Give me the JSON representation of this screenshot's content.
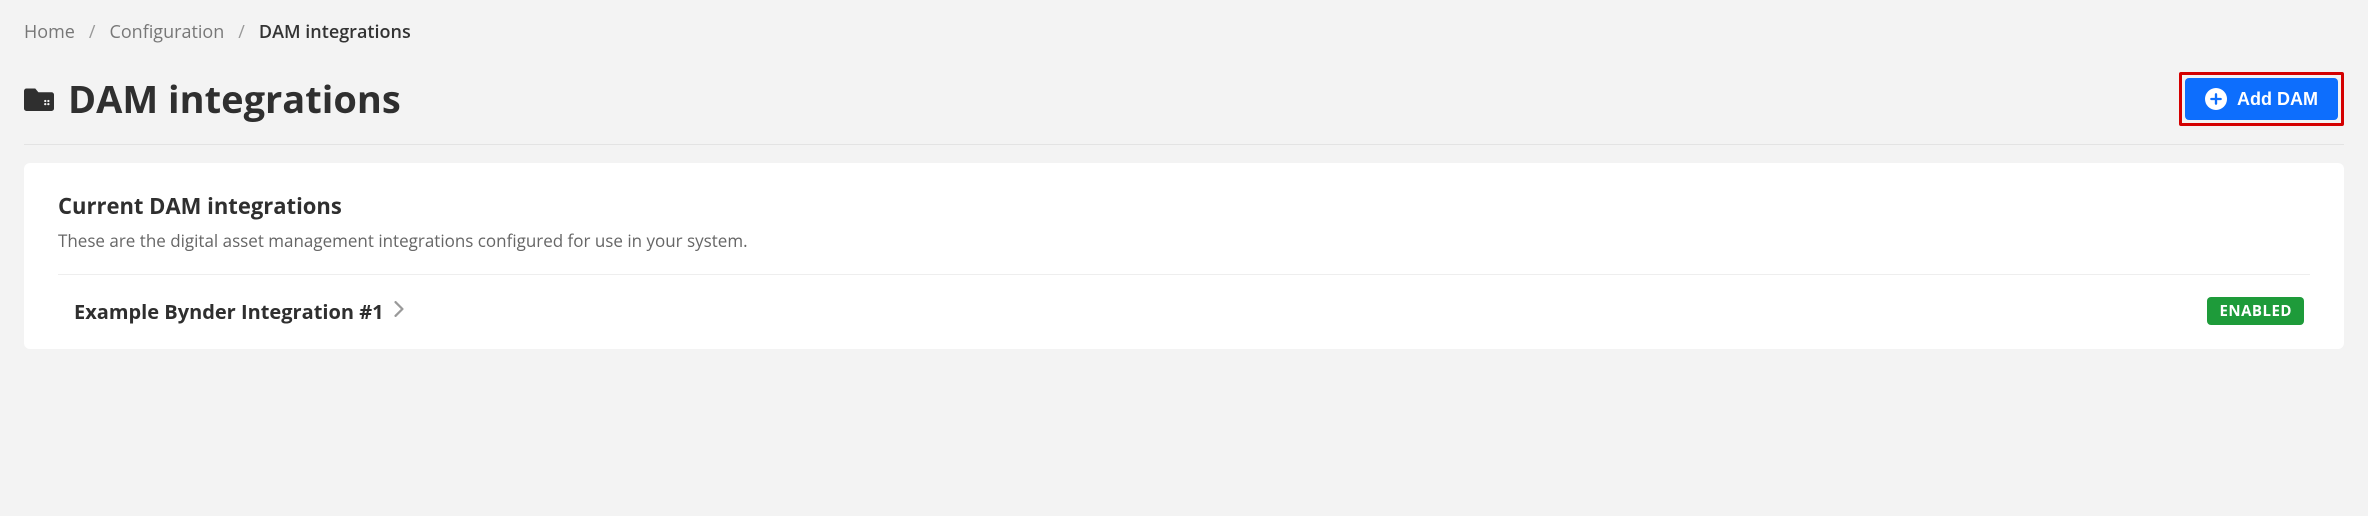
{
  "breadcrumb": {
    "home": "Home",
    "configuration": "Configuration",
    "current": "DAM integrations"
  },
  "page": {
    "title": "DAM integrations",
    "add_button": "Add DAM"
  },
  "card": {
    "title": "Current DAM integrations",
    "description": "These are the digital asset management integrations configured for use in your system."
  },
  "items": [
    {
      "name": "Example Bynder Integration #1",
      "status": "ENABLED"
    }
  ]
}
